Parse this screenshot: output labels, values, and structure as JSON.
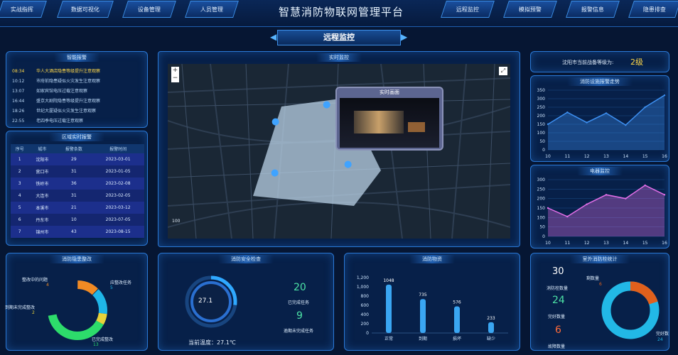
{
  "header": {
    "title": "智慧消防物联网管理平台",
    "nav_left": [
      "实战指挥",
      "数据可视化",
      "设备管理",
      "人员管理"
    ],
    "nav_right": [
      "远程监控",
      "模拟预警",
      "报警信息",
      "隐患排查"
    ],
    "page_title": "远程监控"
  },
  "smart_alarm": {
    "title": "智能报警",
    "items": [
      {
        "time": "08:34",
        "text": "华人大酒店隐患等级提升注意观察",
        "highlight": true
      },
      {
        "time": "10:12",
        "text": "市府前隐患疑似火灾发生注意观察",
        "highlight": false
      },
      {
        "time": "13:07",
        "text": "如家宾馆电压过载注意观察",
        "highlight": false
      },
      {
        "time": "16:44",
        "text": "盛京大剧院隐患等级提升注意观察",
        "highlight": false
      },
      {
        "time": "18:26",
        "text": "世纪大厦疑似火灾发生注意观察",
        "highlight": false
      },
      {
        "time": "22:55",
        "text": "老四季电压过载注意观察",
        "highlight": false
      }
    ]
  },
  "region_alarm": {
    "title": "区域实时报警",
    "headers": [
      "序号",
      "城市",
      "报警条数",
      "报警时间"
    ],
    "rows": [
      [
        "1",
        "沈阳市",
        "29",
        "2023-03-01"
      ],
      [
        "2",
        "营口市",
        "31",
        "2023-01-05"
      ],
      [
        "3",
        "铁岭市",
        "36",
        "2023-02-08"
      ],
      [
        "4",
        "大连市",
        "31",
        "2023-02-05"
      ],
      [
        "5",
        "本溪市",
        "21",
        "2023-03-12"
      ],
      [
        "6",
        "丹东市",
        "10",
        "2023-07-05"
      ],
      [
        "7",
        "锦州市",
        "43",
        "2023-08-15"
      ]
    ]
  },
  "monitor": {
    "title": "实时监控",
    "popup_title": "实时画面",
    "zoom_in": "+",
    "zoom_out": "−",
    "scale": "100"
  },
  "readiness": {
    "label": "沈阳市当前战备等级为:",
    "value": "2级"
  },
  "trend1": {
    "title": "消防设施报警走势",
    "chart_data": {
      "type": "area",
      "x": [
        10,
        11,
        12,
        13,
        14,
        15,
        16
      ],
      "values": [
        150,
        220,
        160,
        215,
        145,
        250,
        320
      ],
      "ylim": [
        0,
        350
      ],
      "yticks": [
        0,
        50,
        100,
        150,
        200,
        250,
        300,
        350
      ],
      "color": "#3d8ff0"
    }
  },
  "trend2": {
    "title": "电器监控",
    "chart_data": {
      "type": "area",
      "x": [
        10,
        11,
        12,
        13,
        14,
        15,
        16
      ],
      "values": [
        150,
        105,
        170,
        220,
        200,
        270,
        220
      ],
      "ylim": [
        0,
        300
      ],
      "yticks": [
        0,
        50,
        100,
        150,
        200,
        250,
        300
      ],
      "color": "#e36fe8"
    }
  },
  "rectify": {
    "title": "消防隐患整改",
    "labels": [
      {
        "name": "整改中的问题",
        "value": "4"
      },
      {
        "name": "应整改任务",
        "value": "5"
      },
      {
        "name": "到期未完成整改",
        "value": "2"
      },
      {
        "name": "已完成整改",
        "value": "13"
      }
    ],
    "colors": [
      "#f08a24",
      "#1fb6e8",
      "#e8d23a",
      "#2ddc6b"
    ]
  },
  "safety": {
    "title": "消防安全检查",
    "gauge_value": "27.1",
    "gauge_fraction": 0.271,
    "done_value": "20",
    "done_label": "已完成任务",
    "undone_value": "9",
    "undone_label": "逾期未完成任务",
    "temp_label": "当前温度：27.1℃"
  },
  "supplies": {
    "title": "消防物资",
    "chart_data": {
      "type": "bar",
      "categories": [
        "正常",
        "到期",
        "损坏",
        "缺少"
      ],
      "values": [
        1048,
        735,
        576,
        233
      ],
      "ylim": [
        0,
        1200
      ],
      "yticks": [
        "0",
        "200",
        "400",
        "600",
        "800",
        "1,000",
        "1,200"
      ]
    }
  },
  "hydrant": {
    "title": "室外消防栓统计",
    "total_value": "30",
    "total_label": "消防栓数量",
    "good_value": "24",
    "good_label": "完好数量",
    "bad_value": "6",
    "bad_label": "故障数量",
    "ring_left": "剩数量",
    "ring_left_value": "6",
    "ring_right": "完好数",
    "ring_right_value": "24",
    "colors": [
      "#e0601c",
      "#22b8e6"
    ]
  }
}
